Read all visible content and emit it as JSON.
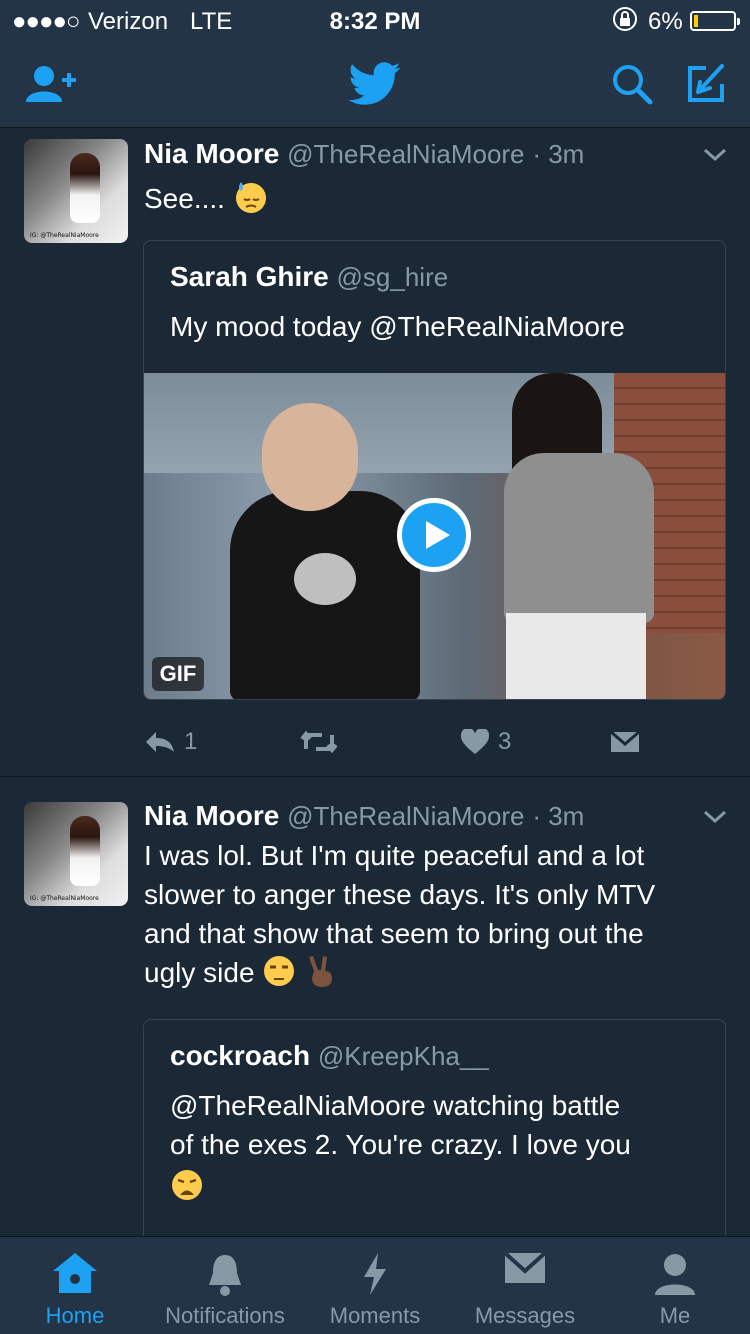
{
  "status_bar": {
    "signal": "●●●●○",
    "carrier": "Verizon",
    "network": "LTE",
    "time": "8:32 PM",
    "battery_percent": "6%"
  },
  "nav": {
    "icons": [
      "add-user-icon",
      "twitter-bird-icon",
      "search-icon",
      "compose-icon"
    ],
    "accent_color": "#1da1f2"
  },
  "tweets": [
    {
      "name": "Nia Moore",
      "handle": "@TheRealNiaMoore",
      "time": "· 3m",
      "text": "See....",
      "emoji": "downcast-sweat-emoji",
      "avatar_watermark": "IG: @TheRealNiaMoore",
      "quote": {
        "name": "Sarah Ghire",
        "handle": "@sg_hire",
        "text": "My mood today @TheRealNiaMoore",
        "media_badge": "GIF"
      },
      "actions": {
        "reply_count": "1",
        "retweet_count": "",
        "like_count": "3"
      }
    },
    {
      "name": "Nia Moore",
      "handle": "@TheRealNiaMoore",
      "time": "· 3m",
      "text_lines": [
        "I was lol. But I'm quite peaceful and a lot",
        "slower to anger these days. It's only MTV",
        "and that show that seem to bring out the",
        "ugly side"
      ],
      "avatar_watermark": "IG: @TheRealNiaMoore",
      "quote": {
        "name": "cockroach",
        "handle": "@KreepKha__",
        "text_lines": [
          "@TheRealNiaMoore watching battle",
          "of the exes 2. You're crazy. I love you"
        ]
      }
    }
  ],
  "tab_bar": {
    "tabs": [
      {
        "label": "Home",
        "active": true
      },
      {
        "label": "Notifications",
        "active": false
      },
      {
        "label": "Moments",
        "active": false
      },
      {
        "label": "Messages",
        "active": false
      },
      {
        "label": "Me",
        "active": false
      }
    ]
  }
}
